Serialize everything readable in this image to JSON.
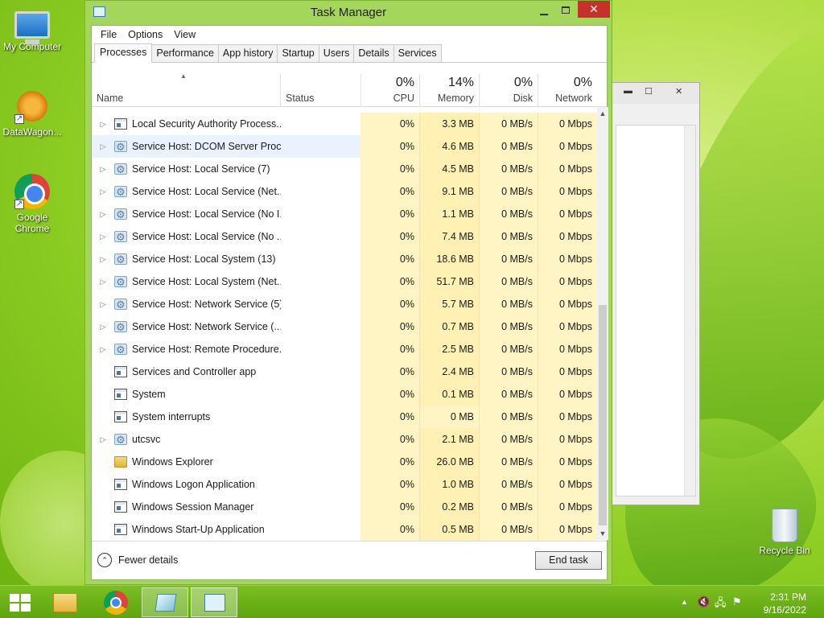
{
  "desktop": {
    "icons": [
      {
        "label": "My Computer"
      },
      {
        "label": "DataWagon..."
      },
      {
        "label": "Google Chrome"
      },
      {
        "label": "Recycle Bin"
      }
    ]
  },
  "window": {
    "title": "Task Manager",
    "menu": [
      "File",
      "Options",
      "View"
    ],
    "tabs": [
      "Processes",
      "Performance",
      "App history",
      "Startup",
      "Users",
      "Details",
      "Services"
    ],
    "active_tab": "Processes",
    "columns": {
      "name": "Name",
      "status": "Status",
      "cpu": {
        "pct": "0%",
        "label": "CPU"
      },
      "memory": {
        "pct": "14%",
        "label": "Memory"
      },
      "disk": {
        "pct": "0%",
        "label": "Disk"
      },
      "network": {
        "pct": "0%",
        "label": "Network"
      }
    },
    "processes": [
      {
        "name": "Local Security Authority Process...",
        "icon": "app-window-icon",
        "expandable": true,
        "cpu": "0%",
        "memory": "3.3 MB",
        "disk": "0 MB/s",
        "network": "0 Mbps"
      },
      {
        "name": "Service Host: DCOM Server Proc...",
        "icon": "service-gear-icon",
        "expandable": true,
        "cpu": "0%",
        "memory": "4.6 MB",
        "disk": "0 MB/s",
        "network": "0 Mbps",
        "highlighted": true
      },
      {
        "name": "Service Host: Local Service (7)",
        "icon": "service-gear-icon",
        "expandable": true,
        "cpu": "0%",
        "memory": "4.5 MB",
        "disk": "0 MB/s",
        "network": "0 Mbps"
      },
      {
        "name": "Service Host: Local Service (Net...",
        "icon": "service-gear-icon",
        "expandable": true,
        "cpu": "0%",
        "memory": "9.1 MB",
        "disk": "0 MB/s",
        "network": "0 Mbps"
      },
      {
        "name": "Service Host: Local Service (No I...",
        "icon": "service-gear-icon",
        "expandable": true,
        "cpu": "0%",
        "memory": "1.1 MB",
        "disk": "0 MB/s",
        "network": "0 Mbps"
      },
      {
        "name": "Service Host: Local Service (No ...",
        "icon": "service-gear-icon",
        "expandable": true,
        "cpu": "0%",
        "memory": "7.4 MB",
        "disk": "0 MB/s",
        "network": "0 Mbps"
      },
      {
        "name": "Service Host: Local System (13)",
        "icon": "service-gear-icon",
        "expandable": true,
        "cpu": "0%",
        "memory": "18.6 MB",
        "disk": "0 MB/s",
        "network": "0 Mbps"
      },
      {
        "name": "Service Host: Local System (Net...",
        "icon": "service-gear-icon",
        "expandable": true,
        "cpu": "0%",
        "memory": "51.7 MB",
        "disk": "0 MB/s",
        "network": "0 Mbps"
      },
      {
        "name": "Service Host: Network Service (5)",
        "icon": "service-gear-icon",
        "expandable": true,
        "cpu": "0%",
        "memory": "5.7 MB",
        "disk": "0 MB/s",
        "network": "0 Mbps"
      },
      {
        "name": "Service Host: Network Service (...",
        "icon": "service-gear-icon",
        "expandable": true,
        "cpu": "0%",
        "memory": "0.7 MB",
        "disk": "0 MB/s",
        "network": "0 Mbps"
      },
      {
        "name": "Service Host: Remote Procedure...",
        "icon": "service-gear-icon",
        "expandable": true,
        "cpu": "0%",
        "memory": "2.5 MB",
        "disk": "0 MB/s",
        "network": "0 Mbps"
      },
      {
        "name": "Services and Controller app",
        "icon": "app-window-icon",
        "expandable": false,
        "cpu": "0%",
        "memory": "2.4 MB",
        "disk": "0 MB/s",
        "network": "0 Mbps"
      },
      {
        "name": "System",
        "icon": "app-window-icon",
        "expandable": false,
        "cpu": "0%",
        "memory": "0.1 MB",
        "disk": "0 MB/s",
        "network": "0 Mbps"
      },
      {
        "name": "System interrupts",
        "icon": "app-window-icon",
        "expandable": false,
        "cpu": "0%",
        "memory": "0 MB",
        "disk": "0 MB/s",
        "network": "0 Mbps"
      },
      {
        "name": "utcsvc",
        "icon": "service-gear-icon",
        "expandable": true,
        "cpu": "0%",
        "memory": "2.1 MB",
        "disk": "0 MB/s",
        "network": "0 Mbps"
      },
      {
        "name": "Windows Explorer",
        "icon": "folder-icon",
        "expandable": false,
        "cpu": "0%",
        "memory": "26.0 MB",
        "disk": "0 MB/s",
        "network": "0 Mbps"
      },
      {
        "name": "Windows Logon Application",
        "icon": "app-window-icon",
        "expandable": false,
        "cpu": "0%",
        "memory": "1.0 MB",
        "disk": "0 MB/s",
        "network": "0 Mbps"
      },
      {
        "name": "Windows Session Manager",
        "icon": "app-window-icon",
        "expandable": false,
        "cpu": "0%",
        "memory": "0.2 MB",
        "disk": "0 MB/s",
        "network": "0 Mbps"
      },
      {
        "name": "Windows Start-Up Application",
        "icon": "app-window-icon",
        "expandable": false,
        "cpu": "0%",
        "memory": "0.5 MB",
        "disk": "0 MB/s",
        "network": "0 Mbps"
      }
    ],
    "footer": {
      "fewer_details": "Fewer details",
      "end_task": "End task"
    }
  },
  "taskbar": {
    "clock_time": "2:31 PM",
    "clock_date": "9/16/2022"
  },
  "colors": {
    "accent_window": "#a4d65c",
    "cpu_highlight": "#fff4c4",
    "memory_highlight": "#fff0b4",
    "close_button": "#c7302b",
    "selection": "#eaf3fd"
  }
}
